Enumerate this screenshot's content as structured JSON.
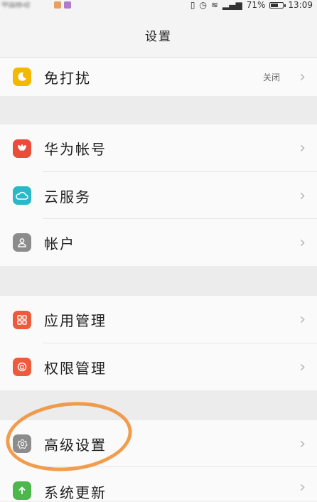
{
  "status_bar": {
    "left_text": "中国移动",
    "battery": "71%",
    "battery_level": 0.71,
    "time": "13:09"
  },
  "header": {
    "title": "设置"
  },
  "groups": [
    {
      "items": [
        {
          "label": "免打扰",
          "value": "关闭",
          "icon": "moon-icon",
          "color": "#f5b800"
        }
      ]
    },
    {
      "items": [
        {
          "label": "华为帐号",
          "icon": "huawei-logo-icon",
          "color": "#ea4c3c"
        },
        {
          "label": "云服务",
          "icon": "cloud-icon",
          "color": "#27b9c8"
        },
        {
          "label": "帐户",
          "icon": "person-icon",
          "color": "#8c8c8c"
        }
      ]
    },
    {
      "items": [
        {
          "label": "应用管理",
          "icon": "apps-grid-icon",
          "color": "#ee5a3c"
        },
        {
          "label": "权限管理",
          "icon": "shield-icon",
          "color": "#ee5a3c"
        }
      ]
    },
    {
      "items": [
        {
          "label": "高级设置",
          "icon": "gear-icon",
          "color": "#8c8c8c"
        },
        {
          "label": "系统更新",
          "icon": "arrow-up-icon",
          "color": "#4cb84c"
        }
      ]
    }
  ],
  "colors": {
    "annotation": "#f0923a",
    "chevron": "#b8b8b8"
  }
}
